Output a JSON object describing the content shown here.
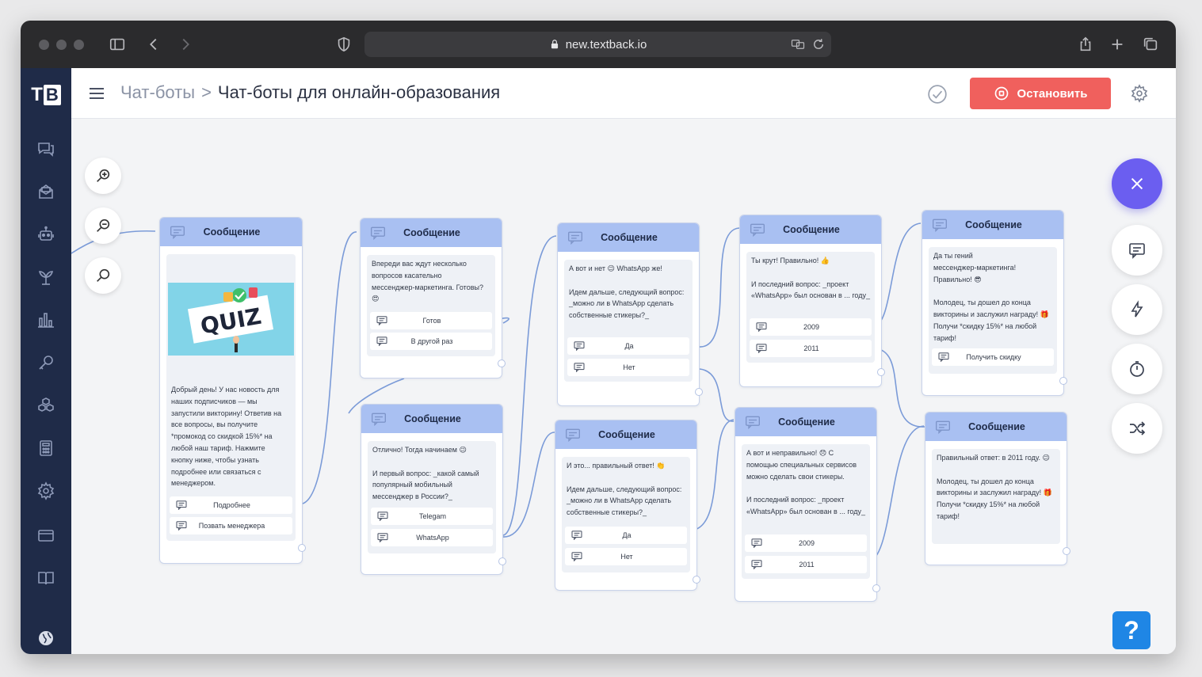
{
  "browser": {
    "url": "new.textback.io"
  },
  "logo": {
    "t": "T",
    "b": "B"
  },
  "header": {
    "breadcrumb_parent": "Чат-боты",
    "breadcrumb_separator": ">",
    "breadcrumb_current": "Чат-боты для онлайн-образования",
    "stop_label": "Остановить",
    "accent": "#f0605d"
  },
  "nodes": [
    {
      "title": "Сообщение",
      "image_text": "QUIZ",
      "text": "Добрый день! У нас новость для\nнаших подписчиков — мы\nзапустили викторину! Ответив на\nвсе вопросы, вы получите\n*промокод со скидкой 15%* на\nлюбой наш тариф. Нажмите\nкнопку ниже, чтобы узнать\nподробнее или связаться с\nменеджером.",
      "buttons": [
        "Подробнее",
        "Позвать менеджера"
      ]
    },
    {
      "title": "Сообщение",
      "text": "Впереди вас ждут несколько\nвопросов касательно\nмессенджер-маркетинга. Готовы?\n😍",
      "buttons": [
        "Готов",
        "В другой раз"
      ]
    },
    {
      "title": "Сообщение",
      "text": "Отлично! Тогда начинаем 😉\n\nИ первый вопрос: _какой самый\nпопулярный мобильный\nмессенджер в России?_",
      "buttons": [
        "Telegam",
        "WhatsApp"
      ]
    },
    {
      "title": "Сообщение",
      "text": "А вот и нет 😉 WhatsApp же!\n\nИдем дальше, следующий вопрос:\n_можно ли в WhatsApp сделать\nсобственные стикеры?_",
      "buttons": [
        "Да",
        "Нет"
      ]
    },
    {
      "title": "Сообщение",
      "text": "И это... правильный ответ! 👏\n\nИдем дальше, следующий вопрос:\n_можно ли в WhatsApp сделать\nсобственные стикеры?_",
      "buttons": [
        "Да",
        "Нет"
      ]
    },
    {
      "title": "Сообщение",
      "text": "Ты крут! Правильно! 👍\n\nИ последний вопрос: _проект\n«WhatsApp» был основан в ... году_",
      "buttons": [
        "2009",
        "2011"
      ]
    },
    {
      "title": "Сообщение",
      "text": "А вот и неправильно! 😞 С\nпомощью специальных сервисов\nможно сделать свои стикеры.\n\nИ последний вопрос: _проект\n«WhatsApp» был основан в ... году_",
      "buttons": [
        "2009",
        "2011"
      ]
    },
    {
      "title": "Сообщение",
      "text": "Да ты гений\nмессенджер-маркетинга!\nПравильно! 😎\n\nМолодец, ты дошел до конца\nвикторины и заслужил награду! 🎁\nПолучи *скидку 15%* на любой\nтариф!",
      "buttons": [
        "Получить скидку"
      ]
    },
    {
      "title": "Сообщение",
      "text": "Правильный ответ: в 2011 году. 😉\n\nМолодец, ты дошел до конца\nвикторины и заслужил награду! 🎁\nПолучи *скидку 15%* на любой\nтариф!",
      "buttons": []
    }
  ],
  "help": {
    "label": "?"
  },
  "colors": {
    "sidebar": "#1f2b48",
    "node_header": "#a9c0f2",
    "fab_close": "#6b5ef0",
    "help": "#1f86e5"
  }
}
